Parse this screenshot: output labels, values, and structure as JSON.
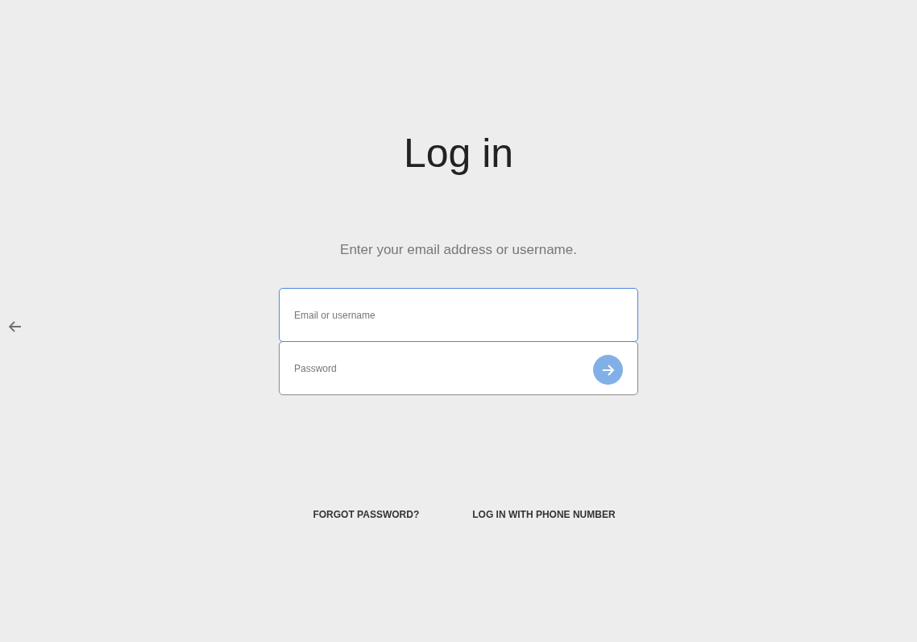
{
  "title": "Log in",
  "subtitle": "Enter your email address or username.",
  "fields": [
    {
      "placeholder": "Email or username",
      "focused": true,
      "kind": "text"
    },
    {
      "placeholder": "Password",
      "focused": false,
      "kind": "password"
    }
  ],
  "links": [
    "FORGOT PASSWORD?",
    "LOG IN WITH PHONE NUMBER"
  ]
}
